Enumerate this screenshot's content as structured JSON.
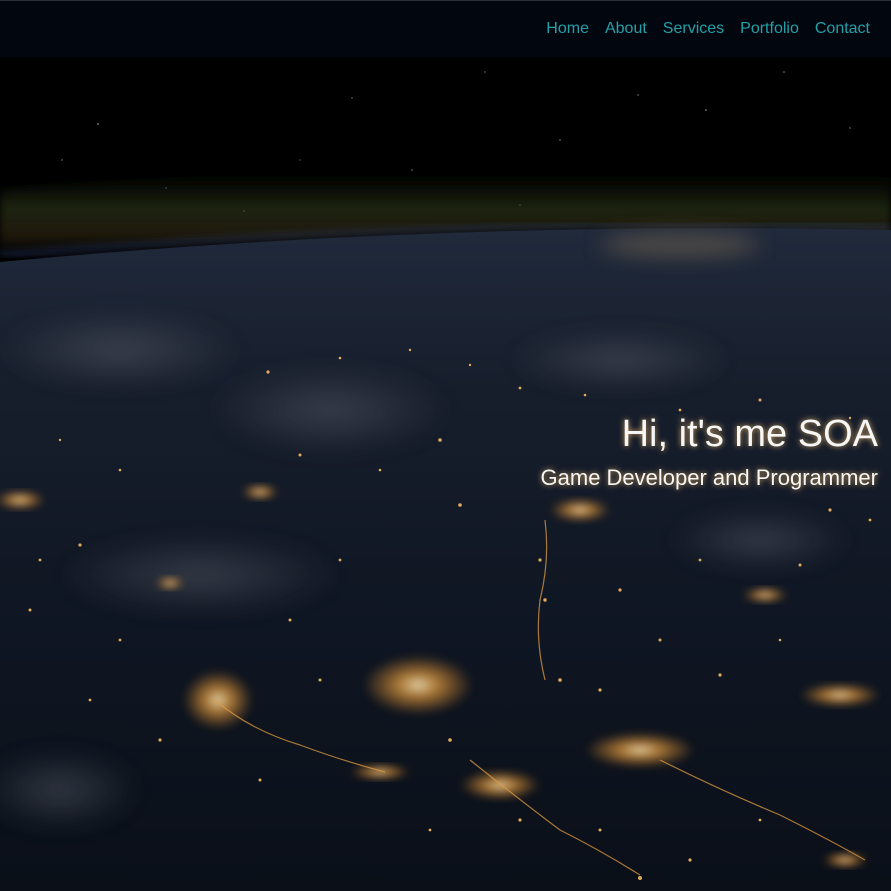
{
  "nav": {
    "items": [
      {
        "label": "Home"
      },
      {
        "label": "About"
      },
      {
        "label": "Services"
      },
      {
        "label": "Portfolio"
      },
      {
        "label": "Contact"
      }
    ]
  },
  "hero": {
    "title": "Hi, it's me SOA",
    "subtitle": "Game Developer and Programmer",
    "background": "earth-at-night-from-space-photo"
  },
  "colors": {
    "nav_background": "#02060f",
    "nav_link": "#25a0a8",
    "hero_text": "#f6f6f6",
    "text_glow": "#ffc878"
  }
}
